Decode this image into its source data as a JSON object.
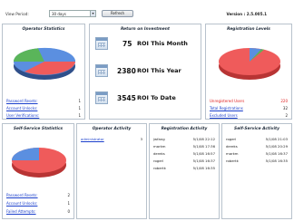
{
  "top": {
    "view_period_label": "View Period:",
    "view_period_value": "30 days",
    "refresh_label": "Refresh",
    "version": "Version : 2.5.005.1"
  },
  "operator_stats": {
    "title": "Operator Statistics",
    "rows": [
      {
        "label": "Password Resets:",
        "value": "1"
      },
      {
        "label": "Account Unlocks:",
        "value": "1"
      },
      {
        "label": "User Verifications:",
        "value": "1"
      }
    ]
  },
  "roi": {
    "title": "Return on Investment",
    "items": [
      {
        "value": "75",
        "label": "ROI This Month"
      },
      {
        "value": "2380",
        "label": "ROI This Year"
      },
      {
        "value": "3545",
        "label": "ROI To Date"
      }
    ]
  },
  "registration_levels": {
    "title": "Registration Levels",
    "rows": [
      {
        "label": "Unregistered Users",
        "value": "220",
        "style": "red"
      },
      {
        "label": "Total Registrations",
        "value": "32",
        "style": "link"
      },
      {
        "label": "Excluded Users",
        "value": "2",
        "style": "link"
      }
    ]
  },
  "self_service_stats": {
    "title": "Self-Service Statistics",
    "rows": [
      {
        "label": "Password Resets:",
        "value": "2"
      },
      {
        "label": "Account Unlocks:",
        "value": "1"
      },
      {
        "label": "Failed Attempts:",
        "value": "0"
      }
    ]
  },
  "operator_activity": {
    "title": "Operator Activity",
    "rows": [
      {
        "user": "administrator",
        "value": "3"
      }
    ]
  },
  "registration_activity": {
    "title": "Registration Activity",
    "rows": [
      {
        "user": "jwfang",
        "time": "5/1/08 22:12"
      },
      {
        "user": "markm",
        "time": "5/1/08 17:36"
      },
      {
        "user": "dereks",
        "time": "5/1/08 16:57"
      },
      {
        "user": "rogerl",
        "time": "5/1/08 16:37"
      },
      {
        "user": "robertk",
        "time": "5/1/08 16:35"
      }
    ]
  },
  "self_service_activity": {
    "title": "Self-Service Activity",
    "rows": [
      {
        "user": "rogerl",
        "time": "5/1/08 21:03"
      },
      {
        "user": "dereks",
        "time": "5/1/08 20:29"
      },
      {
        "user": "markm",
        "time": "5/1/08 16:37"
      },
      {
        "user": "robertk",
        "time": "5/1/08 16:35"
      }
    ]
  },
  "colors": {
    "pie_red": "#ef5b5b",
    "pie_blue": "#5b8fe0",
    "pie_green": "#5ab55a",
    "link": "#1a3fcc",
    "border": "#b8c2cc"
  }
}
